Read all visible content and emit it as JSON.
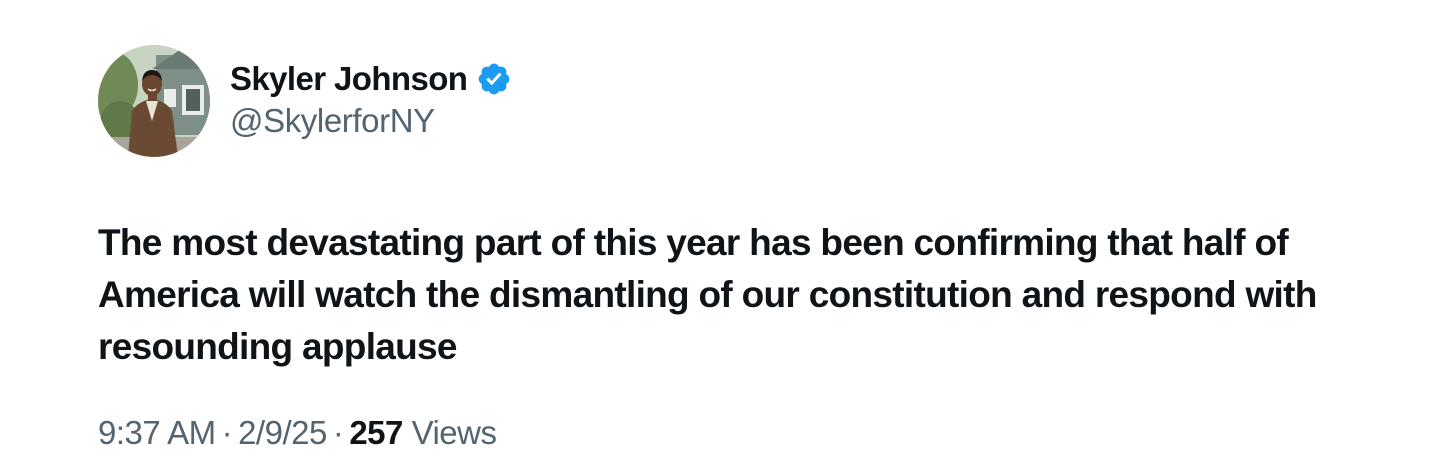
{
  "author": {
    "display_name": "Skyler Johnson",
    "handle": "@SkylerforNY",
    "verified": true,
    "verified_icon": "verified-badge-icon",
    "verified_color": "#1d9bf0"
  },
  "tweet": {
    "text": "The most devastating part of this year has been confirming that half of America will watch the dismantling of our constitution and respond with resounding applause"
  },
  "meta": {
    "time": "9:37 AM",
    "date": "2/9/25",
    "separator": "·",
    "views_count": "257",
    "views_label": "Views"
  },
  "colors": {
    "text_primary": "#0f1419",
    "text_secondary": "#536471",
    "accent": "#1d9bf0"
  }
}
